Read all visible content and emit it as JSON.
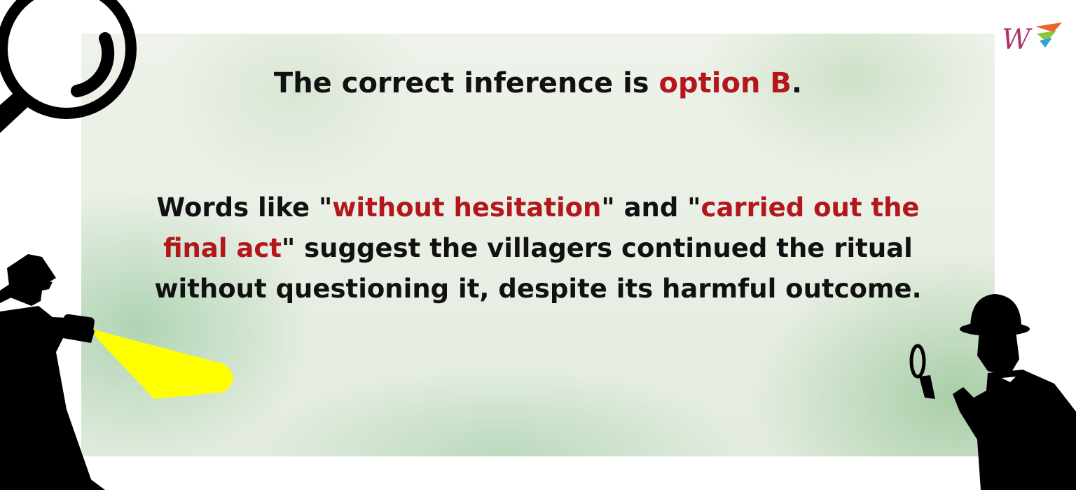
{
  "headline": {
    "prefix": "The correct inference is ",
    "answer": "option B",
    "suffix": "."
  },
  "explanation": {
    "part1": "Words like \"",
    "quote1": "without hesitation",
    "part2": "\" and \"",
    "quote2": "carried out the final act",
    "part3": "\" suggest the villagers continued the ritual without questioning it, despite its harmful outcome."
  },
  "colors": {
    "highlight": "#b3161b",
    "text": "#111111",
    "flashlight_beam": "#ffff00"
  },
  "icons": [
    "magnifying-glass-icon",
    "detective-flashlight-icon",
    "detective-magnifier-icon",
    "brand-logo-icon"
  ]
}
